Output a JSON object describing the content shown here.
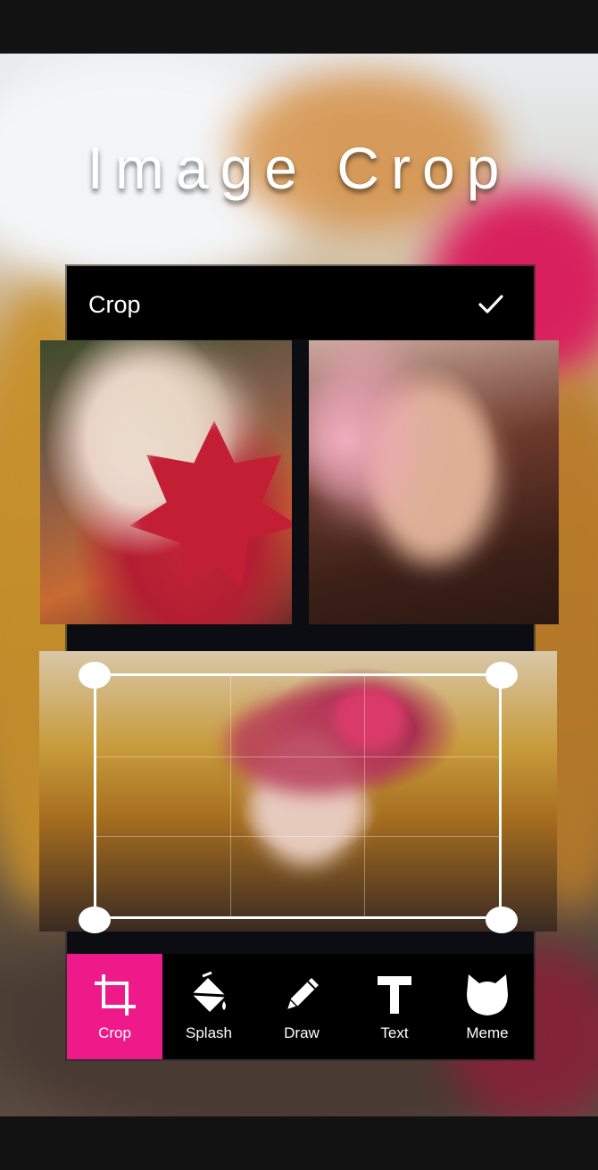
{
  "promo": {
    "headline": "Image Crop"
  },
  "editor": {
    "title": "Crop",
    "confirm_icon": "check-icon"
  },
  "tools": [
    {
      "label": "Crop",
      "icon": "crop-icon",
      "active": true
    },
    {
      "label": "Splash",
      "icon": "splash-bucket-icon",
      "active": false
    },
    {
      "label": "Draw",
      "icon": "pencil-icon",
      "active": false
    },
    {
      "label": "Text",
      "icon": "text-icon",
      "active": false
    },
    {
      "label": "Meme",
      "icon": "cat-mask-icon",
      "active": false
    }
  ],
  "colors": {
    "accent": "#ee1a8a",
    "toolbar_bg": "#000000",
    "header_bg": "#000000"
  }
}
